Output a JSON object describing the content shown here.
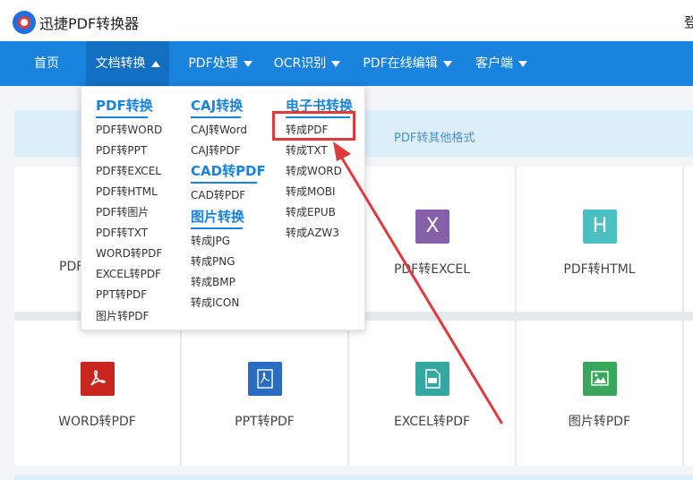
{
  "header": {
    "brand": "迅捷PDF转换器",
    "login": "登"
  },
  "nav": [
    {
      "label": "首页",
      "arrow": ""
    },
    {
      "label": "文档转换",
      "arrow": "up"
    },
    {
      "label": "PDF处理",
      "arrow": "down"
    },
    {
      "label": "OCR识别",
      "arrow": "down"
    },
    {
      "label": "PDF在线编辑",
      "arrow": "down"
    },
    {
      "label": "客户端",
      "arrow": "down"
    }
  ],
  "banner": {
    "text": "PDF转其他格式"
  },
  "dropdown": {
    "col1": {
      "heading": "PDF转换",
      "items": [
        "PDF转WORD",
        "PDF转PPT",
        "PDF转EXCEL",
        "PDF转HTML",
        "PDF转图片",
        "PDF转TXT",
        "WORD转PDF",
        "EXCEL转PDF",
        "PPT转PDF",
        "图片转PDF"
      ]
    },
    "col2": {
      "caj_heading": "CAJ转换",
      "caj_items": [
        "CAJ转Word",
        "CAJ转PDF"
      ],
      "cad_heading": "CAD转PDF",
      "cad_items": [
        "CAD转PDF"
      ],
      "img_heading": "图片转换",
      "img_items": [
        "转成JPG",
        "转成PNG",
        "转成BMP",
        "转成ICON"
      ]
    },
    "col3": {
      "heading": "电子书转换",
      "items": [
        "转成PDF",
        "转成TXT",
        "转成WORD",
        "转成MOBI",
        "转成EPUB",
        "转成AZW3"
      ]
    }
  },
  "cards": {
    "row1": [
      {
        "label": "PDF",
        "icon": "pdf-word-icon",
        "color": ""
      },
      {
        "label": "",
        "icon": "",
        "color": ""
      },
      {
        "label": "PDF转EXCEL",
        "icon": "excel-x-icon",
        "glyph": "X",
        "color": "#8560a8"
      },
      {
        "label": "PDF转HTML",
        "icon": "html-h-icon",
        "glyph": "H",
        "color": "#4bbfc2"
      }
    ],
    "row2": [
      {
        "label": "WORD转PDF",
        "icon": "pdf-acrobat-icon",
        "color": "#c8261f"
      },
      {
        "label": "PPT转PDF",
        "icon": "pdf-doc-icon",
        "color": "#2a6cc0"
      },
      {
        "label": "EXCEL转PDF",
        "icon": "pdf-file-icon",
        "color": "#34a8a0"
      },
      {
        "label": "图片转PDF",
        "icon": "image-icon",
        "color": "#3aa65c"
      }
    ]
  },
  "colors": {
    "nav": "#1a83de",
    "nav_active": "#136fc2",
    "accent": "#1a83de",
    "highlight": "#e0393e"
  }
}
